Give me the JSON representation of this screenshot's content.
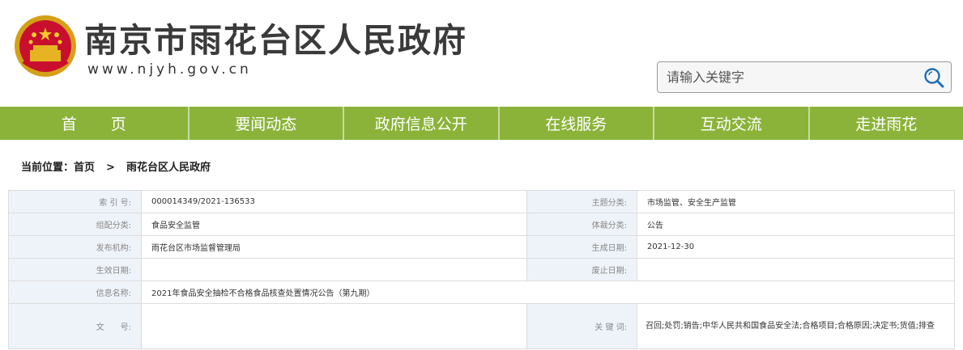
{
  "header": {
    "site_title": "南京市雨花台区人民政府",
    "site_url": "www.njyh.gov.cn",
    "emblem_icon": "national-emblem-icon"
  },
  "search": {
    "placeholder": "请输入关键字",
    "icon": "search-icon"
  },
  "nav": {
    "items": [
      {
        "label": "首页"
      },
      {
        "label": "要闻动态"
      },
      {
        "label": "政府信息公开"
      },
      {
        "label": "在线服务"
      },
      {
        "label": "互动交流"
      },
      {
        "label": "走进雨花"
      }
    ]
  },
  "breadcrumb": {
    "prefix": "当前位置：",
    "home": "首页",
    "separator": ">",
    "current": "雨花台区人民政府"
  },
  "info": {
    "index_label": "索 引 号:",
    "index_value": "000014349/2021-136533",
    "topic_label": "主题分类:",
    "topic_value": "市场监管、安全生产监管",
    "org_label": "组配分类:",
    "org_value": "食品安全监管",
    "genre_label": "体裁分类:",
    "genre_value": "公告",
    "publisher_label": "发布机构:",
    "publisher_value": "雨花台区市场监督管理局",
    "created_label": "生成日期:",
    "created_value": "2021-12-30",
    "effective_label": "生效日期:",
    "effective_value": "",
    "expiry_label": "废止日期:",
    "expiry_value": "",
    "name_label": "信息名称:",
    "name_value": "2021年食品安全抽检不合格食品核查处置情况公告（第九期）",
    "doc_label": "文　　号:",
    "doc_value": "",
    "keywords_label": "关 键 词:",
    "keywords_value": "召回;处罚;销告;中华人民共和国食品安全法;合格项目;合格原因;决定书;货值;排查"
  },
  "colors": {
    "nav_green": "#8bb33a",
    "label_bg": "#eef3fa"
  }
}
